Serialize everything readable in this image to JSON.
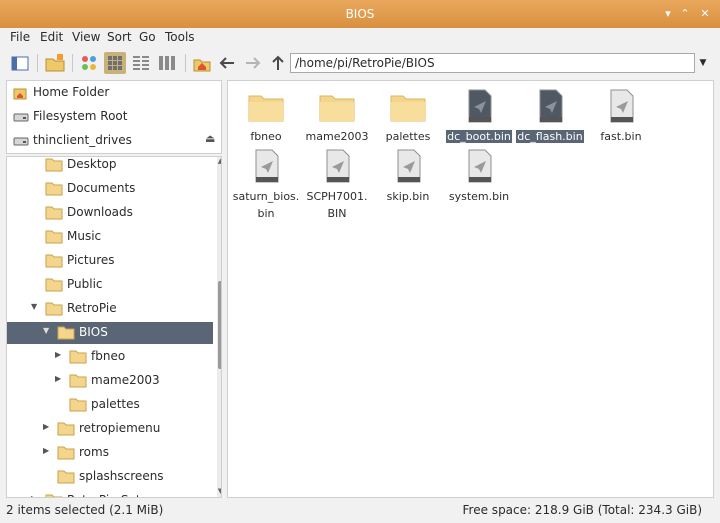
{
  "window": {
    "title": "BIOS"
  },
  "menu": [
    "File",
    "Edit",
    "View",
    "Sort",
    "Go",
    "Tools"
  ],
  "toolbar": {
    "path": "/home/pi/RetroPie/BIOS",
    "icons": [
      "sidebar-toggle-icon",
      "new-tab-icon",
      "view-icons-icon",
      "view-thumbnails-icon",
      "view-compact-icon",
      "view-list-icon",
      "home-icon",
      "back-arrow-icon",
      "forward-arrow-icon",
      "up-arrow-icon"
    ]
  },
  "places": [
    {
      "label": "Home Folder",
      "icon": "home-icon"
    },
    {
      "label": "Filesystem Root",
      "icon": "drive-icon"
    },
    {
      "label": "thinclient_drives",
      "icon": "drive-icon",
      "eject": "⏏"
    }
  ],
  "tree": [
    {
      "label": "Desktop",
      "depth": 2,
      "expander": ""
    },
    {
      "label": "Documents",
      "depth": 2,
      "expander": ""
    },
    {
      "label": "Downloads",
      "depth": 2,
      "expander": ""
    },
    {
      "label": "Music",
      "depth": 2,
      "expander": ""
    },
    {
      "label": "Pictures",
      "depth": 2,
      "expander": ""
    },
    {
      "label": "Public",
      "depth": 2,
      "expander": ""
    },
    {
      "label": "RetroPie",
      "depth": 2,
      "expander": "▼"
    },
    {
      "label": "BIOS",
      "depth": 3,
      "expander": "▼",
      "selected": true
    },
    {
      "label": "fbneo",
      "depth": 4,
      "expander": "▶"
    },
    {
      "label": "mame2003",
      "depth": 4,
      "expander": "▶"
    },
    {
      "label": "palettes",
      "depth": 4,
      "expander": ""
    },
    {
      "label": "retropiemenu",
      "depth": 3,
      "expander": "▶"
    },
    {
      "label": "roms",
      "depth": 3,
      "expander": "▶"
    },
    {
      "label": "splashscreens",
      "depth": 3,
      "expander": ""
    },
    {
      "label": "RetroPie-Setup",
      "depth": 2,
      "expander": "▶"
    }
  ],
  "files": [
    {
      "name": "fbneo",
      "kind": "folder",
      "selected": false
    },
    {
      "name": "mame2003",
      "kind": "folder",
      "selected": false
    },
    {
      "name": "palettes",
      "kind": "folder",
      "selected": false
    },
    {
      "name": "dc_boot.bin",
      "kind": "file",
      "selected": true
    },
    {
      "name": "dc_flash.bin",
      "kind": "file",
      "selected": true
    },
    {
      "name": "fast.bin",
      "kind": "file",
      "selected": false
    },
    {
      "name": "saturn_bios.\nbin",
      "kind": "file",
      "selected": false
    },
    {
      "name": "SCPH7001.\nBIN",
      "kind": "file",
      "selected": false
    },
    {
      "name": "skip.bin",
      "kind": "file",
      "selected": false
    },
    {
      "name": "system.bin",
      "kind": "file",
      "selected": false
    }
  ],
  "status": {
    "selection": "2 items selected (2.1 MiB)",
    "space": "Free space: 218.9 GiB (Total: 234.3 GiB)"
  },
  "colors": {
    "accent": "#e9a35a",
    "selection": "#5a6675",
    "folder": "#f3d58c"
  }
}
